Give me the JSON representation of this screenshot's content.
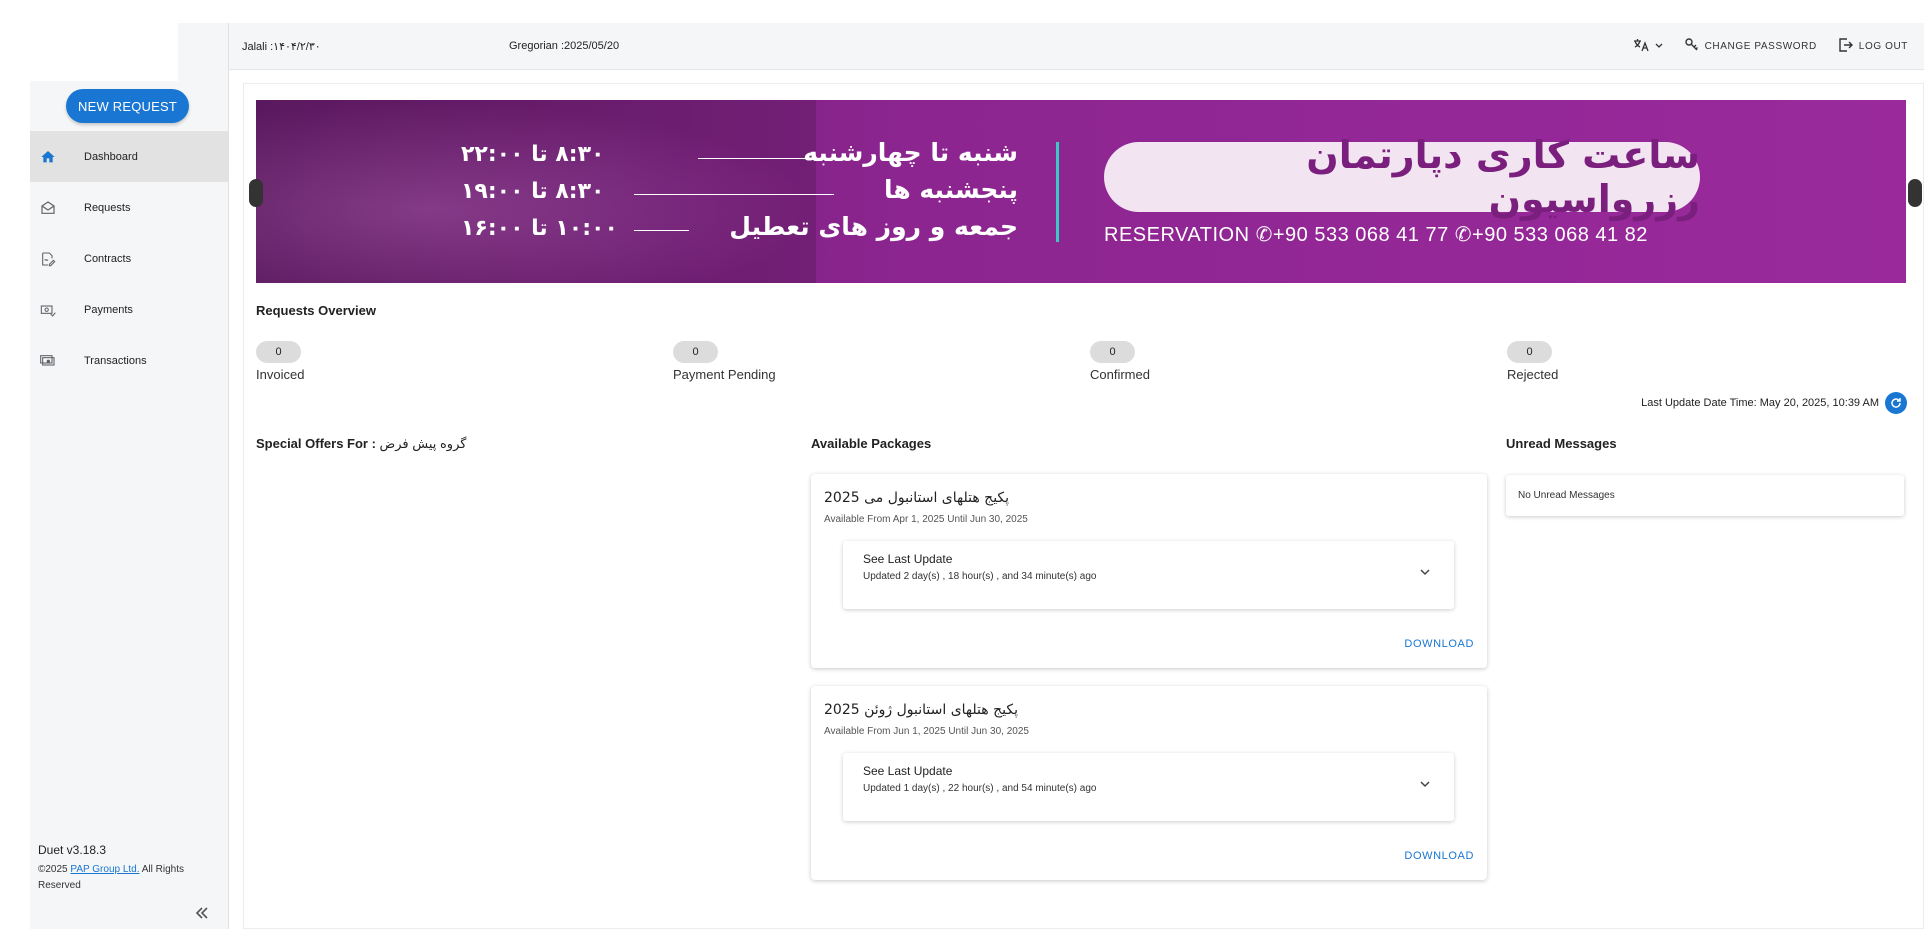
{
  "sidebar": {
    "new_request_label": "NEW REQUEST",
    "items": [
      {
        "label": "Dashboard",
        "icon": "home-icon",
        "active": true
      },
      {
        "label": "Requests",
        "icon": "envelope-icon",
        "active": false
      },
      {
        "label": "Contracts",
        "icon": "contract-icon",
        "active": false
      },
      {
        "label": "Payments",
        "icon": "payment-icon",
        "active": false
      },
      {
        "label": "Transactions",
        "icon": "cash-icon",
        "active": false
      }
    ],
    "version": "Duet v3.18.3",
    "copyright_prefix": "©2025 ",
    "company_link": "PAP Group Ltd.",
    "copyright_suffix": " All Rights Reserved"
  },
  "header": {
    "jalali": "Jalali :۱۴۰۴/۲/۳۰",
    "gregorian": "Gregorian :2025/05/20",
    "change_password": "CHANGE PASSWORD",
    "log_out": "LOG OUT"
  },
  "banner": {
    "title": "ساعت کاری دپارتمان رزرواسیون",
    "contact": "RESERVATION  ✆+90 533 068 41 77  ✆+90 533 068 41 82",
    "lines": [
      {
        "label": "شنبه تا چهارشنبه",
        "time": "۸:۳۰ تا ۲۲:۰۰"
      },
      {
        "label": "پنجشنبه ها",
        "time": "۸:۳۰ تا ۱۹:۰۰"
      },
      {
        "label": "جمعه و روز های تعطیل",
        "time": "۱۰:۰۰ تا ۱۶:۰۰"
      }
    ]
  },
  "overview": {
    "title": "Requests Overview",
    "stats": [
      {
        "count": "0",
        "label": "Invoiced"
      },
      {
        "count": "0",
        "label": "Payment Pending"
      },
      {
        "count": "0",
        "label": "Confirmed"
      },
      {
        "count": "0",
        "label": "Rejected"
      }
    ],
    "last_update": "Last Update Date Time: May 20, 2025, 10:39 AM"
  },
  "offers": {
    "label": "Special Offers For : ",
    "group": "گروه پیش فرض"
  },
  "packages": {
    "title": "Available Packages",
    "items": [
      {
        "title": "پکیج هتلهای استانبول می 2025",
        "available": "Available From Apr 1, 2025 Until Jun 30, 2025",
        "update_title": "See Last Update",
        "update_sub": "Updated 2 day(s) , 18 hour(s) , and 34 minute(s) ago",
        "download": "DOWNLOAD"
      },
      {
        "title": "پکیج هتلهای استانبول ژوئن 2025",
        "available": "Available From Jun 1, 2025 Until Jun 30, 2025",
        "update_title": "See Last Update",
        "update_sub": "Updated 1 day(s) , 22 hour(s) , and 54 minute(s) ago",
        "download": "DOWNLOAD"
      }
    ]
  },
  "messages": {
    "title": "Unread Messages",
    "empty": "No Unread Messages"
  },
  "colors": {
    "primary": "#1976d2",
    "banner": "#8c2590",
    "sidebar_bg": "#f5f6f7"
  }
}
